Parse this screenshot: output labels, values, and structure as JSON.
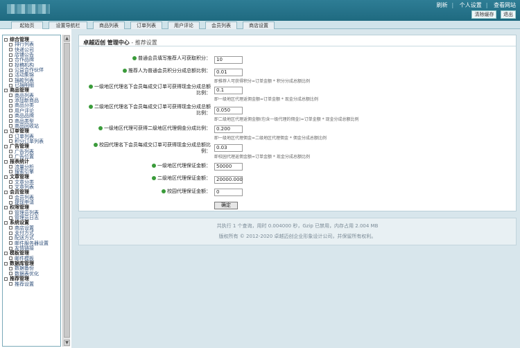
{
  "header": {
    "links": [
      "刷新",
      "个人设置",
      "查看网站"
    ],
    "buttons": [
      "清除缓存",
      "退出"
    ]
  },
  "nav": {
    "tabs": [
      "起始页",
      "设置导航栏",
      "商品列表",
      "订单列表",
      "用户评论",
      "会员列表",
      "商店设置"
    ]
  },
  "sidebar": {
    "groups": [
      {
        "title": "综合管理",
        "items": [
          "排行列表",
          "快递公司",
          "店铺公告",
          "合作品牌",
          "投稿机构",
          "公益合作伙伴",
          "活动集锦",
          "捐款列表",
          "已捐明细"
        ]
      },
      {
        "title": "商品管理",
        "items": [
          "商品列表",
          "添加新商品",
          "商品分类",
          "用户评论",
          "商品品牌",
          "商品类型",
          "商品回收站"
        ]
      },
      {
        "title": "订单管理",
        "items": [
          "订单列表",
          "积分订单列表"
        ]
      },
      {
        "title": "广告管理",
        "items": [
          "广告列表",
          "广告位置"
        ]
      },
      {
        "title": "报表统计",
        "items": [
          "流量分析",
          "搜索引擎"
        ]
      },
      {
        "title": "文章管理",
        "items": [
          "文章分类",
          "文章列表"
        ]
      },
      {
        "title": "会员管理",
        "items": [
          "会员列表",
          "提现申请"
        ]
      },
      {
        "title": "权限管理",
        "items": [
          "管理员列表",
          "管理员日志"
        ]
      },
      {
        "title": "系统设置",
        "items": [
          "商店设置",
          "支付方式",
          "配送方式",
          "邮件服务器设置",
          "友情链接"
        ]
      },
      {
        "title": "模板管理",
        "items": [
          "邮件模板"
        ]
      },
      {
        "title": "数据库管理",
        "items": [
          "数据备份",
          "数据表优化"
        ]
      },
      {
        "title": "推荐管理",
        "items": [
          "推荐设置"
        ]
      }
    ]
  },
  "page": {
    "title": "卓越迈创 管理中心",
    "subtitle": " - 推荐设置"
  },
  "form": {
    "fields": [
      {
        "label": "普通会员填写推荐人可获取积分：",
        "value": "10",
        "hint": "",
        "help": true
      },
      {
        "label": "推荐人为普通会员积分分成总额比例：",
        "value": "0.01",
        "hint": "即推荐人可获得积分=订单金额 * 积分分成总额比例",
        "help": true
      },
      {
        "label": "一级地区代理名下会员每成交订单可获得现金分成总额比例：",
        "value": "0.1",
        "hint": "即一级地区代理返佣金额=订单金额 * 现金分成总额比例",
        "help": true
      },
      {
        "label": "二级地区代理名下会员每成交订单可获得现金分成总额比例：",
        "value": "0.050",
        "hint": "即二级地区代理返佣金额(包含一级代理的佣金)=订单金额 * 现金分成总额比例",
        "help": true
      },
      {
        "label": "一级地区代理可获得二级地区代理佣金分成比例：",
        "value": "0.200",
        "hint": "即一级地区代理佣金=二级地区代理佣金 * 佣金分成总额比例",
        "help": true
      },
      {
        "label": "校园代理名下会员每成交订单可获得现金分成总额比例：",
        "value": "0.03",
        "hint": "即校园代理返佣金额=订单金额 * 现金分成总额比例",
        "help": true
      },
      {
        "label": "一级地区代理保证金额：",
        "value": "50000",
        "hint": "",
        "help": true
      },
      {
        "label": "二级地区代理保证金额：",
        "value": "20000.000",
        "hint": "",
        "help": true
      },
      {
        "label": "校园代理保证金额：",
        "value": "0",
        "hint": "",
        "help": true
      }
    ],
    "submit_label": "确定"
  },
  "footer": {
    "stats": "共执行 1 个查询，用时 0.004000 秒，Gzip 已禁用，内存占用 2.004 MB",
    "copyright": "版权所有 © 2012-2020 卓越迈创企业形象设计公司，并保留所有权利。"
  }
}
